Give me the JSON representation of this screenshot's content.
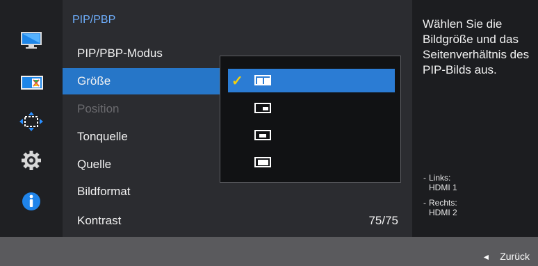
{
  "menu": {
    "title": "PIP/PBP",
    "items": [
      {
        "label": "PIP/PBP-Modus",
        "value": ""
      },
      {
        "label": "Größe",
        "value": ""
      },
      {
        "label": "Position",
        "value": ""
      },
      {
        "label": "Tonquelle",
        "value": ""
      },
      {
        "label": "Quelle",
        "value": ""
      },
      {
        "label": "Bildformat",
        "value": ""
      },
      {
        "label": "Kontrast",
        "value": "75/75"
      }
    ],
    "selected_index": 1,
    "disabled_index": 2
  },
  "sidebar": {
    "icons": [
      "monitor-icon",
      "picture-in-picture-icon",
      "move-arrows-icon",
      "gear-icon",
      "info-icon"
    ]
  },
  "dropdown": {
    "options": [
      "split-screen-size-icon",
      "small-window-size-icon",
      "medium-window-size-icon",
      "large-window-size-icon"
    ],
    "selected_index": 0
  },
  "help": {
    "text": "Wählen Sie die Bildgröße und das Seitenverhältnis des PIP-Bilds aus.",
    "left_label": "Links:",
    "left_value": "HDMI 1",
    "right_label": "Rechts:",
    "right_value": "HDMI 2"
  },
  "footer": {
    "back_label": "Zurück",
    "back_icon": "back-arrow-icon"
  },
  "colors": {
    "accent_blue": "#2676c8",
    "title_blue": "#6fb0ff",
    "check_yellow": "#f5d10c",
    "panel": "#2b2c30"
  }
}
